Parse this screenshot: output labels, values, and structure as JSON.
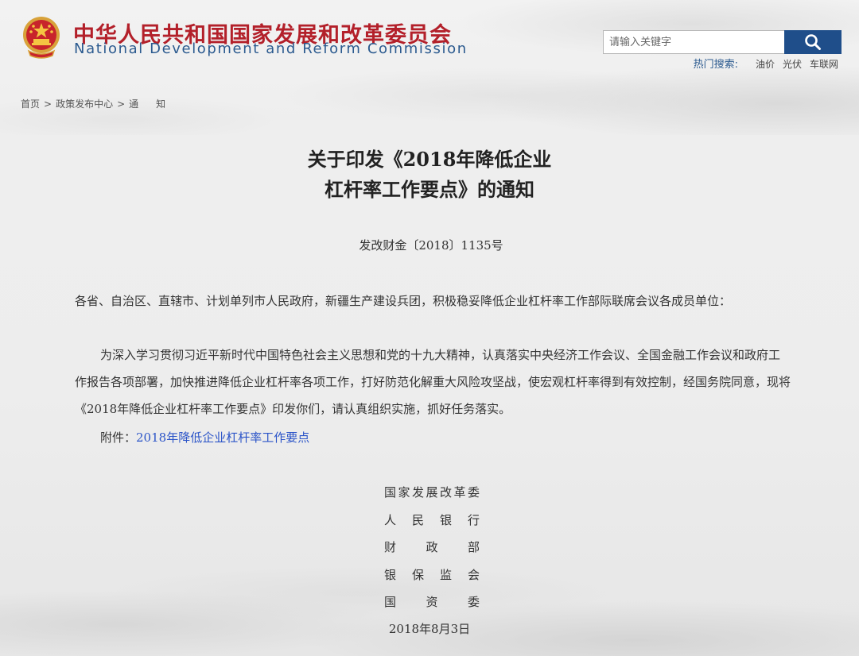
{
  "header": {
    "title_cn": "中华人民共和国国家发展和改革委员会",
    "title_en": "National Development and Reform Commission",
    "emblem_icon": "national-emblem-icon"
  },
  "search": {
    "placeholder": "请输入关键字",
    "button_icon": "search-icon",
    "hot_label": "热门搜索:",
    "hot_items": [
      "油价",
      "光伏",
      "车联网"
    ]
  },
  "breadcrumb": {
    "items": [
      "首页",
      "政策发布中心",
      "通知"
    ],
    "separator": ">"
  },
  "article": {
    "title_line1": "关于印发《2018年降低企业",
    "title_line2": "杠杆率工作要点》的通知",
    "doc_number": "发改财金〔2018〕1135号",
    "addressee": "各省、自治区、直辖市、计划单列市人民政府，新疆生产建设兵团，积极稳妥降低企业杠杆率工作部际联席会议各成员单位：",
    "body": "为深入学习贯彻习近平新时代中国特色社会主义思想和党的十九大精神，认真落实中央经济工作会议、全国金融工作会议和政府工作报告各项部署，加快推进降低企业杠杆率各项工作，打好防范化解重大风险攻坚战，使宏观杠杆率得到有效控制，经国务院同意，现将《2018年降低企业杠杆率工作要点》印发你们，请认真组织实施，抓好任务落实。",
    "attachment_label": "附件：",
    "attachment_link": "2018年降低企业杠杆率工作要点",
    "signatories": [
      "国家发展改革委",
      "人民银行",
      "财政部",
      "银保监会",
      "国资委"
    ],
    "date": "2018年8月3日"
  },
  "colors": {
    "title_red": "#b3202a",
    "title_blue": "#2b5a8f",
    "search_button": "#1f4e8a",
    "link_blue": "#2b54c8"
  }
}
